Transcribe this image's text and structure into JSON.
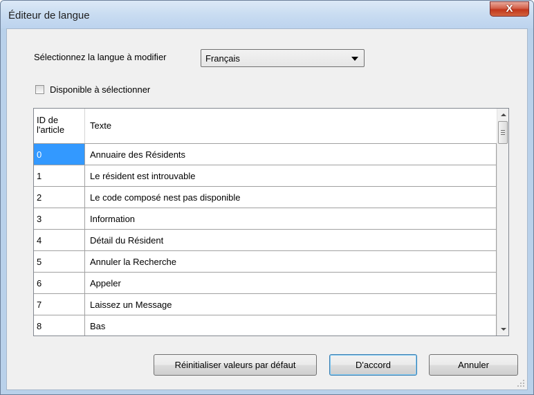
{
  "window": {
    "title": "Éditeur de langue",
    "close_glyph": "X"
  },
  "language": {
    "label": "Sélectionnez la langue à modifier",
    "selected": "Français"
  },
  "available": {
    "label": "Disponible à sélectionner",
    "checked": false
  },
  "grid": {
    "columns": {
      "id": "ID de l'article",
      "text": "Texte"
    },
    "rows": [
      {
        "id": "0",
        "text": "Annuaire des Résidents"
      },
      {
        "id": "1",
        "text": "Le résident est introuvable"
      },
      {
        "id": "2",
        "text": "Le code composé nest pas disponible"
      },
      {
        "id": "3",
        "text": "Information"
      },
      {
        "id": "4",
        "text": "Détail du Résident"
      },
      {
        "id": "5",
        "text": "Annuler la Recherche"
      },
      {
        "id": "6",
        "text": "Appeler"
      },
      {
        "id": "7",
        "text": "Laissez un Message"
      },
      {
        "id": "8",
        "text": "Bas"
      }
    ],
    "selected_row": 0
  },
  "buttons": {
    "reset": "Réinitialiser valeurs par défaut",
    "ok": "D'accord",
    "cancel": "Annuler"
  }
}
